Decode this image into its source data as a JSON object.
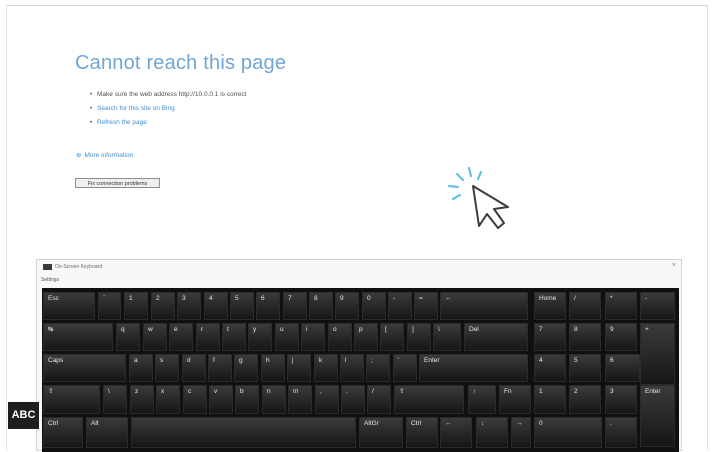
{
  "error_page": {
    "title": "Cannot reach this page",
    "bullets": [
      {
        "text": "Make sure the web address http://10.0.0.1 is correct",
        "link": false
      },
      {
        "text": "Search for this site on Bing",
        "link": true
      },
      {
        "text": "Refresh the page",
        "link": true
      }
    ],
    "more_info": "More information",
    "more_info_icon": "plus-icon",
    "fix_button": "Fix connection problems"
  },
  "cursor_icon": "click-cursor-icon",
  "keyboard": {
    "title": "On-Screen Keyboard",
    "menu": "Settings",
    "close": "×",
    "app_icon": "keyboard-icon",
    "rows": [
      [
        {
          "label": "Esc"
        },
        {
          "label": "`"
        },
        {
          "label": "1"
        },
        {
          "label": "2"
        },
        {
          "label": "3"
        },
        {
          "label": "4"
        },
        {
          "label": "5"
        },
        {
          "label": "6"
        },
        {
          "label": "7"
        },
        {
          "label": "8"
        },
        {
          "label": "9"
        },
        {
          "label": "0"
        },
        {
          "label": "-"
        },
        {
          "label": "="
        },
        {
          "label": "←"
        },
        {
          "label": "Home"
        },
        {
          "label": "/"
        },
        {
          "label": "*"
        },
        {
          "label": "-"
        }
      ],
      [
        {
          "label": "↹"
        },
        {
          "label": "q"
        },
        {
          "label": "w"
        },
        {
          "label": "e"
        },
        {
          "label": "r"
        },
        {
          "label": "t"
        },
        {
          "label": "y"
        },
        {
          "label": "u"
        },
        {
          "label": "i"
        },
        {
          "label": "o"
        },
        {
          "label": "p"
        },
        {
          "label": "["
        },
        {
          "label": "]"
        },
        {
          "label": "\\"
        },
        {
          "label": "Del"
        },
        {
          "label": "7"
        },
        {
          "label": "8"
        },
        {
          "label": "9"
        },
        {
          "label": "+"
        }
      ],
      [
        {
          "label": "Caps"
        },
        {
          "label": "a"
        },
        {
          "label": "s"
        },
        {
          "label": "d"
        },
        {
          "label": "f"
        },
        {
          "label": "g"
        },
        {
          "label": "h"
        },
        {
          "label": "j"
        },
        {
          "label": "k"
        },
        {
          "label": "l"
        },
        {
          "label": ";"
        },
        {
          "label": "'"
        },
        {
          "label": "Enter"
        },
        {
          "label": "4"
        },
        {
          "label": "5"
        },
        {
          "label": "6"
        }
      ],
      [
        {
          "label": "⇧"
        },
        {
          "label": "\\"
        },
        {
          "label": "z"
        },
        {
          "label": "x"
        },
        {
          "label": "c"
        },
        {
          "label": "v"
        },
        {
          "label": "b"
        },
        {
          "label": "n"
        },
        {
          "label": "m"
        },
        {
          "label": ","
        },
        {
          "label": "."
        },
        {
          "label": "/"
        },
        {
          "label": "⇧"
        },
        {
          "label": "↑"
        },
        {
          "label": "Fn"
        },
        {
          "label": "1"
        },
        {
          "label": "2"
        },
        {
          "label": "3"
        },
        {
          "label": "Enter"
        }
      ],
      [
        {
          "label": "Ctrl"
        },
        {
          "label": "Alt"
        },
        {
          "label": ""
        },
        {
          "label": "AltGr"
        },
        {
          "label": "Ctrl"
        },
        {
          "label": "←"
        },
        {
          "label": "↓"
        },
        {
          "label": "→"
        },
        {
          "label": "0"
        },
        {
          "label": "."
        }
      ]
    ]
  },
  "abc_badge": "ABC"
}
